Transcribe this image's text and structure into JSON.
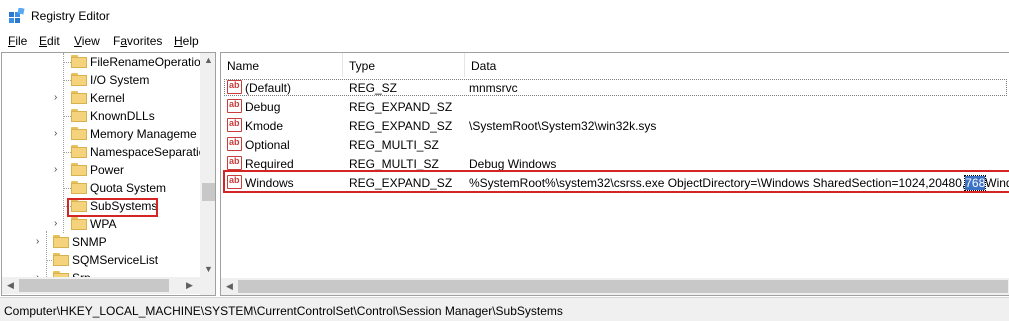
{
  "window": {
    "title": "Registry Editor"
  },
  "menu": [
    {
      "prefix": "",
      "underline": "F",
      "rest": "ile"
    },
    {
      "prefix": "",
      "underline": "E",
      "rest": "dit"
    },
    {
      "prefix": "",
      "underline": "V",
      "rest": "iew"
    },
    {
      "prefix": "F",
      "underline": "a",
      "rest": "vorites"
    },
    {
      "prefix": "",
      "underline": "H",
      "rest": "elp"
    }
  ],
  "tree": {
    "items": [
      {
        "label": "FileRenameOperatio",
        "expander": ""
      },
      {
        "label": "I/O System",
        "expander": ""
      },
      {
        "label": "Kernel",
        "expander": "›"
      },
      {
        "label": "KnownDLLs",
        "expander": ""
      },
      {
        "label": "Memory Manageme",
        "expander": "›"
      },
      {
        "label": "NamespaceSeparatic",
        "expander": ""
      },
      {
        "label": "Power",
        "expander": "›"
      },
      {
        "label": "Quota System",
        "expander": ""
      },
      {
        "label": "SubSystems",
        "expander": ""
      },
      {
        "label": "WPA",
        "expander": "›"
      },
      {
        "label": "SNMP",
        "expander": "›"
      },
      {
        "label": "SQMServiceList",
        "expander": ""
      },
      {
        "label": "Srp",
        "expander": "›"
      }
    ]
  },
  "list": {
    "columns": [
      "Name",
      "Type",
      "Data"
    ],
    "rows": [
      {
        "name": "(Default)",
        "type": "REG_SZ",
        "data": "mnmsrvc"
      },
      {
        "name": "Debug",
        "type": "REG_EXPAND_SZ",
        "data": ""
      },
      {
        "name": "Kmode",
        "type": "REG_EXPAND_SZ",
        "data": "\\SystemRoot\\System32\\win32k.sys"
      },
      {
        "name": "Optional",
        "type": "REG_MULTI_SZ",
        "data": ""
      },
      {
        "name": "Required",
        "type": "REG_MULTI_SZ",
        "data": "Debug Windows"
      },
      {
        "name": "Windows",
        "type": "REG_EXPAND_SZ",
        "data": "%SystemRoot%\\system32\\csrss.exe ObjectDirectory=\\Windows SharedSection=1024,20480,",
        "data_selected": "768",
        "data_tail": "Windows"
      }
    ],
    "icon_text": "ab"
  },
  "status": {
    "path": "Computer\\HKEY_LOCAL_MACHINE\\SYSTEM\\CurrentControlSet\\Control\\Session Manager\\SubSystems"
  },
  "colors": {
    "highlight": "#d42424",
    "selection": "#3a72c6",
    "folder": "#f4d37c"
  }
}
